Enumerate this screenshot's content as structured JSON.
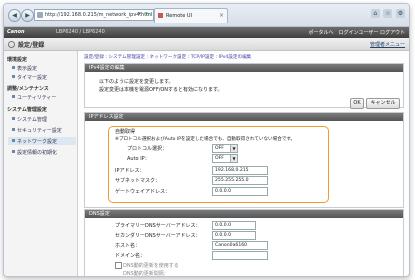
{
  "browser": {
    "nav_back": "◀",
    "nav_forward": "▶",
    "url": "http://192.168.0.215/m_network_ipv4.html",
    "tab_title": "Remote UI",
    "icons": [
      "home-icon",
      "star-icon",
      "gear-icon"
    ]
  },
  "header": {
    "brand": "Canon",
    "model": "LBP6240 / LBP6240",
    "links": "ポータルへ　ログインユーザー ログアウト"
  },
  "subheader": {
    "title": "設定/登録",
    "admin_link": "管理者メニュー"
  },
  "sidebar": {
    "sections": [
      {
        "label": "環境設定",
        "items": [
          "表示設定",
          "タイマー設定"
        ]
      },
      {
        "label": "調整/メンテナンス",
        "items": [
          "ユーティリティー"
        ]
      },
      {
        "label": "システム管理設定",
        "items": [
          "システム管理",
          "セキュリティー設定",
          "ネットワーク設定",
          "設定情報の初期化"
        ]
      }
    ]
  },
  "breadcrumb": "設定/登録 : システム管理設定 : ネットワーク設定 : TCP/IP設定 : IPv4設定の編集",
  "panel_top": {
    "title": "IPv4設定の編集",
    "line1": "以下のように設定を変更します。",
    "line2": "設定変更は本機を電源OFF/ONすると有効になります。",
    "ok": "OK",
    "cancel": "キャンセル"
  },
  "ip_settings": {
    "title": "IPアドレス設定",
    "auto_get": "自動取得",
    "auto_note": "※プロトコル選択およびAuto IPを設定した場合でも、自動取得されていない場合です。",
    "protocol_label": "プロトコル選択：",
    "protocol_value": "OFF",
    "autoip_label": "Auto IP：",
    "autoip_value": "OFF",
    "ip_label": "IPアドレス：",
    "ip_value": "192.168.0.215",
    "mask_label": "サブネットマスク：",
    "mask_value": "255.255.255.0",
    "gw_label": "ゲートウェイアドレス：",
    "gw_value": "0.0.0.0"
  },
  "dns": {
    "title": "DNS設定",
    "primary_label": "プライマリーDNSサーバーアドレス：",
    "primary_value": "0.0.0.0",
    "secondary_label": "セカンダリーDNSサーバーアドレス：",
    "secondary_value": "0.0.0.0",
    "host_label": "ホスト名：",
    "host_value": "Canon0a6160",
    "domain_label": "ドメイン名：",
    "domain_value": "",
    "dyn_label1": "DNS動的更新を使用する",
    "dyn_label2": "DNS動的更新間隔："
  },
  "colors": {
    "highlight": "#f29a2e",
    "header": "#4a4a4a"
  }
}
